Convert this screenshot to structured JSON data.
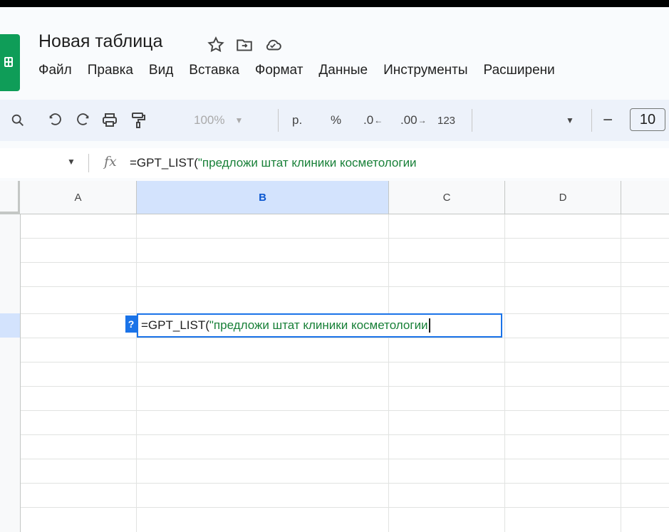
{
  "document": {
    "title": "Новая таблица"
  },
  "menu": [
    "Файл",
    "Правка",
    "Вид",
    "Вставка",
    "Формат",
    "Данные",
    "Инструменты",
    "Расширени"
  ],
  "toolbar": {
    "zoom": "100%",
    "currency": "р.",
    "percent": "%",
    "decrease_decimal": ".0",
    "increase_decimal": ".00",
    "number_format": "123",
    "font_size": "10",
    "font_size_minus": "−"
  },
  "formula_bar": {
    "fx_label": "fx",
    "prefix": "=GPT_LIST(",
    "string": "\"предложи штат клиники косметологии"
  },
  "grid": {
    "columns": [
      "A",
      "B",
      "C",
      "D"
    ],
    "selected_column": "B",
    "active_cell": {
      "prefix": "=GPT_LIST(",
      "string": "\"предложи штат клиники косметологии",
      "help_badge": "?"
    }
  },
  "colors": {
    "accent": "#1a73e8",
    "string": "#188038",
    "brand": "#0f9d58",
    "toolbar_bg": "#edf2fa"
  }
}
